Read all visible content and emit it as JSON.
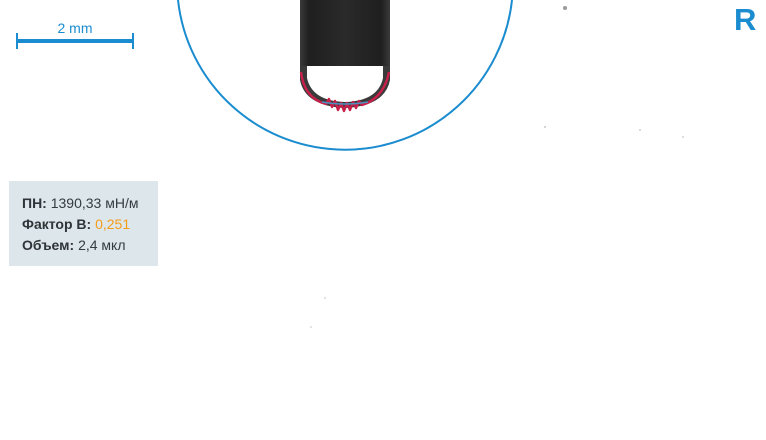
{
  "scale_bar": {
    "label": "2 mm",
    "color": "#1a8ccf"
  },
  "side_indicator": {
    "letter": "R",
    "color": "#1a8ccf"
  },
  "results": {
    "surface_tension": {
      "label": "ПН:",
      "value": "1390,33 мН/м"
    },
    "b_factor": {
      "label": "Фактор B:",
      "value": "0,251",
      "value_color": "#f49c1a"
    },
    "volume": {
      "label": "Объем:",
      "value": "2,4 мкл"
    }
  },
  "image": {
    "needle_color": "#2b2b2b",
    "fit_circle_color": "#1a8ccf",
    "contour_color": "#c8204a"
  }
}
